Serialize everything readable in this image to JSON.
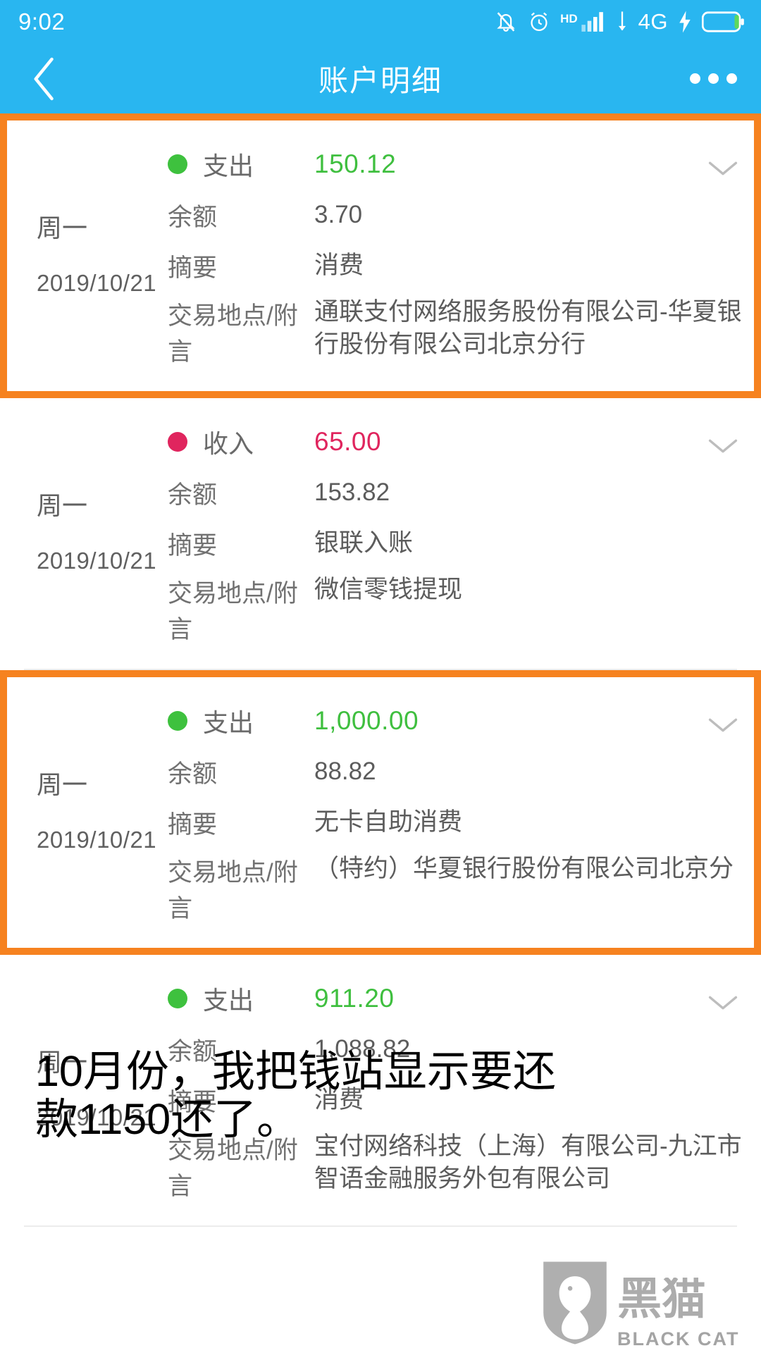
{
  "status_bar": {
    "time": "9:02",
    "network_label": "4G",
    "hd_label": "HD",
    "icons": [
      "mute-icon",
      "alarm-icon",
      "hd-icon",
      "signal-icon",
      "download-icon",
      "4g-icon",
      "charging-icon",
      "battery-icon"
    ]
  },
  "nav": {
    "title": "账户明细",
    "back_icon": "chevron-left-icon",
    "more_icon": "more-options-icon"
  },
  "colors": {
    "header": "#29b6f0",
    "highlight": "#F6821F",
    "expense": "#3fbf3f",
    "income": "#e0255e"
  },
  "labels": {
    "balance": "余额",
    "summary": "摘要",
    "location": "交易地点/附言",
    "expense": "支出",
    "income": "收入"
  },
  "transactions": [
    {
      "weekday": "周一",
      "date": "2019/10/21",
      "type": "支出",
      "direction": "expense",
      "amount": "150.12",
      "balance": "3.70",
      "summary": "消费",
      "location": "通联支付网络服务股份有限公司-华夏银行股份有限公司北京分行",
      "highlighted": true
    },
    {
      "weekday": "周一",
      "date": "2019/10/21",
      "type": "收入",
      "direction": "income",
      "amount": "65.00",
      "balance": "153.82",
      "summary": "银联入账",
      "location": "微信零钱提现",
      "highlighted": false
    },
    {
      "weekday": "周一",
      "date": "2019/10/21",
      "type": "支出",
      "direction": "expense",
      "amount": "1,000.00",
      "balance": "88.82",
      "summary": "无卡自助消费",
      "location": "（特约）华夏银行股份有限公司北京分",
      "highlighted": true
    },
    {
      "weekday": "周一",
      "date": "2019/10/21",
      "type": "支出",
      "direction": "expense",
      "amount": "911.20",
      "balance": "1,088.82",
      "summary": "消费",
      "location": "宝付网络科技（上海）有限公司-九江市智语金融服务外包有限公司",
      "highlighted": false
    }
  ],
  "overlay_caption": "10月份，我把钱站显示要还款1150还了。",
  "watermark": {
    "cn": "黑猫",
    "en": "BLACK CAT"
  }
}
